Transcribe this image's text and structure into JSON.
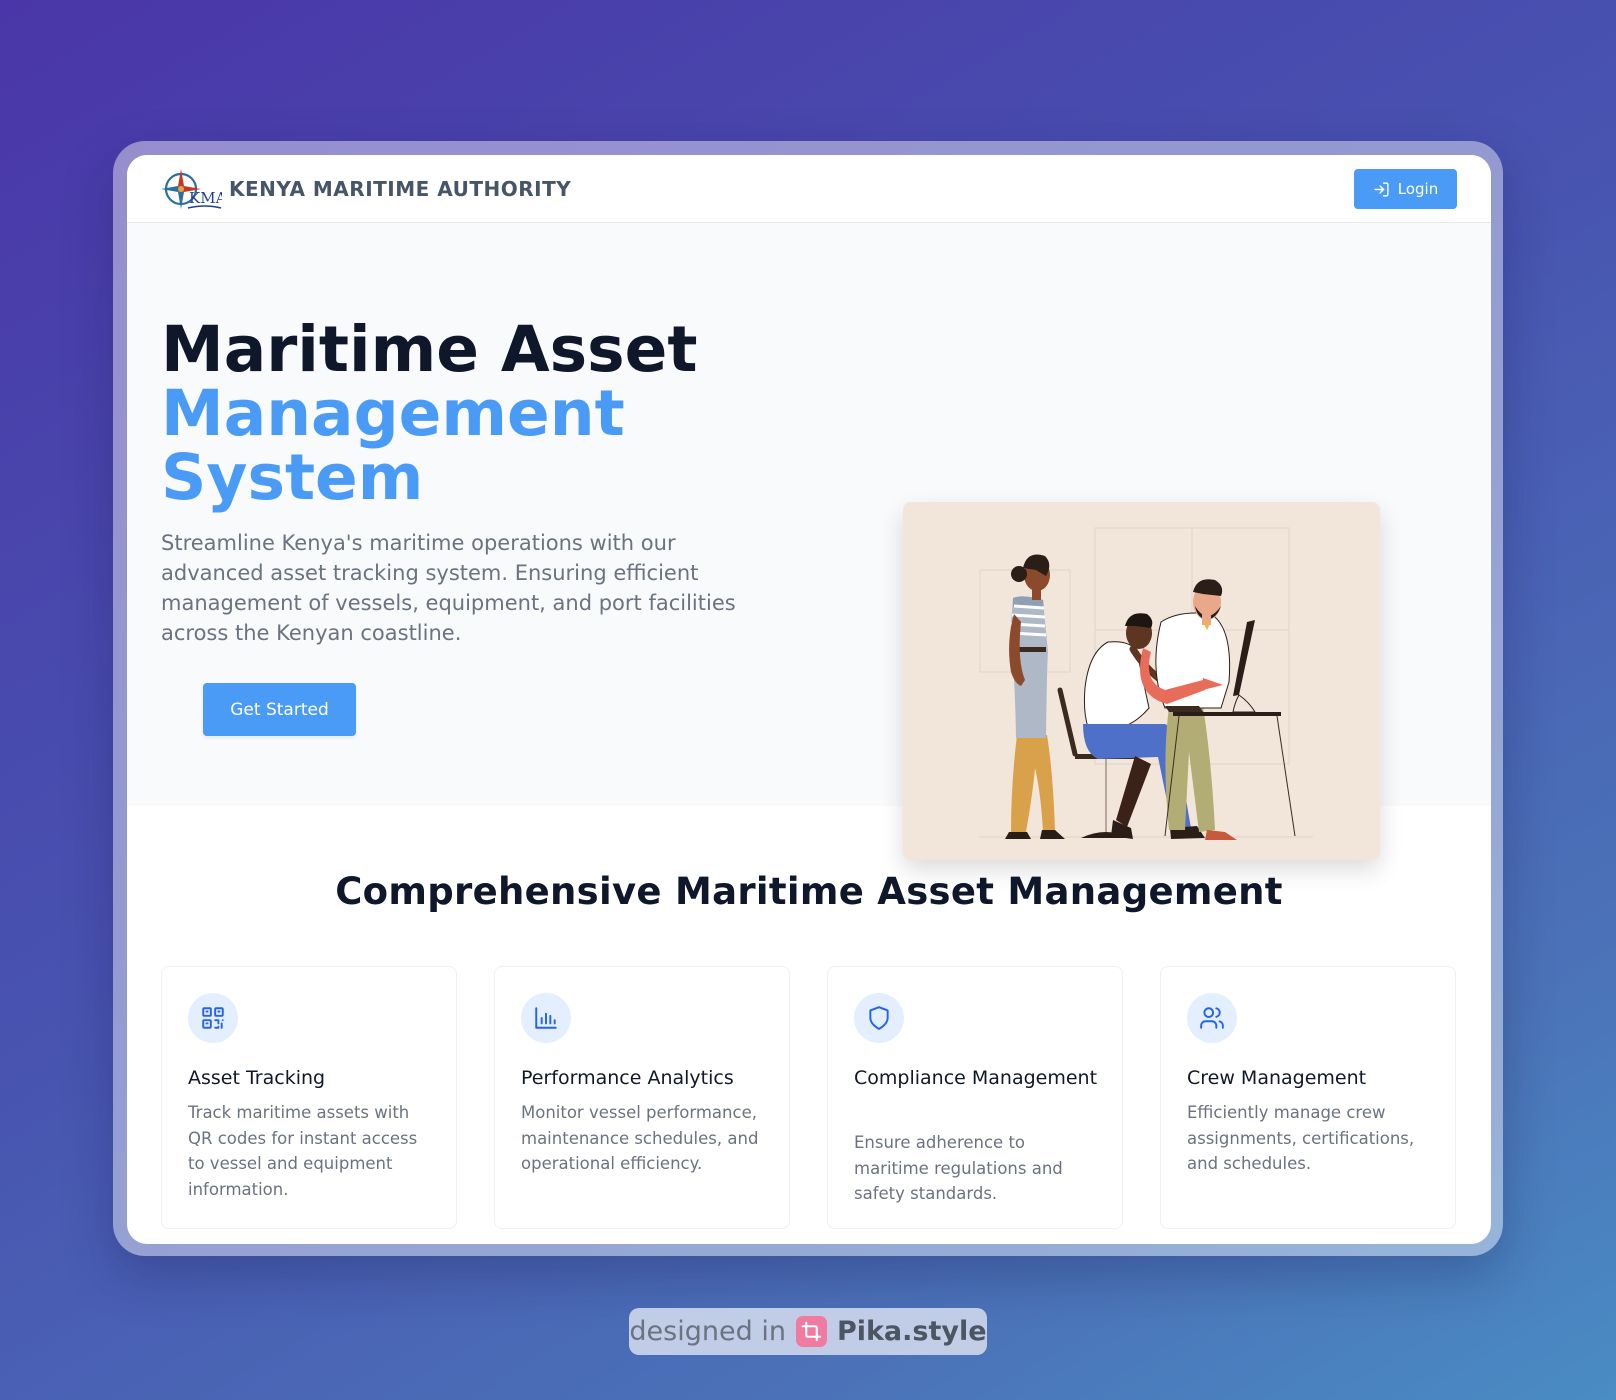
{
  "brand": {
    "logo_text": "KMA",
    "name": "KENYA MARITIME AUTHORITY"
  },
  "nav": {
    "login_label": "Login",
    "login_icon": "log-in-icon"
  },
  "hero": {
    "title_line1": "Maritime Asset",
    "title_line2": "Management",
    "title_line3": "System",
    "description": "Streamline Kenya's maritime operations with our advanced asset tracking system. Ensuring efficient management of vessels, equipment, and port facilities across the Kenyan coastline.",
    "cta_label": "Get Started",
    "illustration": "team-at-workstation-illustration"
  },
  "features": {
    "title": "Comprehensive Maritime Asset Management",
    "cards": [
      {
        "icon": "qr-code-icon",
        "title": "Asset Tracking",
        "description": "Track maritime assets with QR codes for instant access to vessel and equipment information."
      },
      {
        "icon": "bar-chart-icon",
        "title": "Performance Analytics",
        "description": "Monitor vessel performance, maintenance schedules, and operational efficiency."
      },
      {
        "icon": "shield-icon",
        "title": "Compliance Management",
        "description": "Ensure adherence to maritime regulations and safety standards."
      },
      {
        "icon": "users-icon",
        "title": "Crew Management",
        "description": "Efficiently manage crew assignments, certifications, and schedules."
      }
    ]
  },
  "watermark": {
    "prefix": "designed in",
    "brand": "Pika.style"
  },
  "colors": {
    "accent": "#4a9bf5",
    "heading": "#0f172a",
    "muted_text": "#6b7280",
    "icon_bg": "#e3efff",
    "icon_stroke": "#2563eb"
  }
}
